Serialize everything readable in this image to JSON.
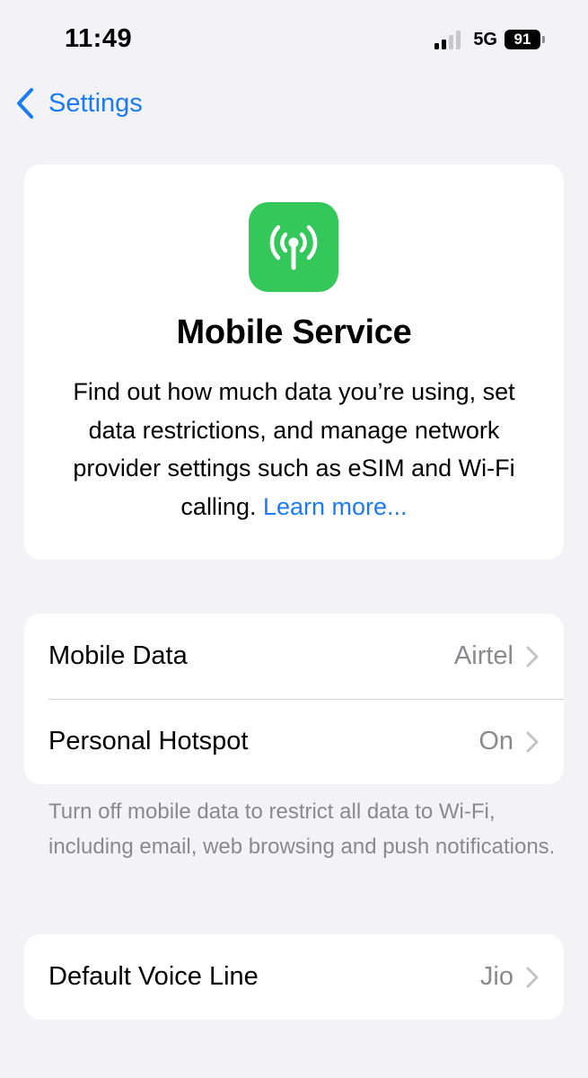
{
  "status_bar": {
    "time": "11:49",
    "network": "5G",
    "battery": "91"
  },
  "nav": {
    "back_label": "Settings"
  },
  "hero": {
    "icon": "antenna-icon",
    "title": "Mobile Service",
    "description": "Find out how much data you’re using, set data restrictions, and manage network provider settings such as eSIM and Wi-Fi calling.",
    "link": "Learn more..."
  },
  "rows": [
    {
      "label": "Mobile Data",
      "value": "Airtel"
    },
    {
      "label": "Personal Hotspot",
      "value": "On"
    }
  ],
  "footer_note": "Turn off mobile data to restrict all data to Wi-Fi, including email, web browsing and push notifications.",
  "voice_row": {
    "label": "Default Voice Line",
    "value": "Jio"
  },
  "colors": {
    "accent": "#1a7cf0",
    "icon_green": "#34c759",
    "background": "#f2f2f7",
    "secondary_text": "#8a8a8e"
  }
}
